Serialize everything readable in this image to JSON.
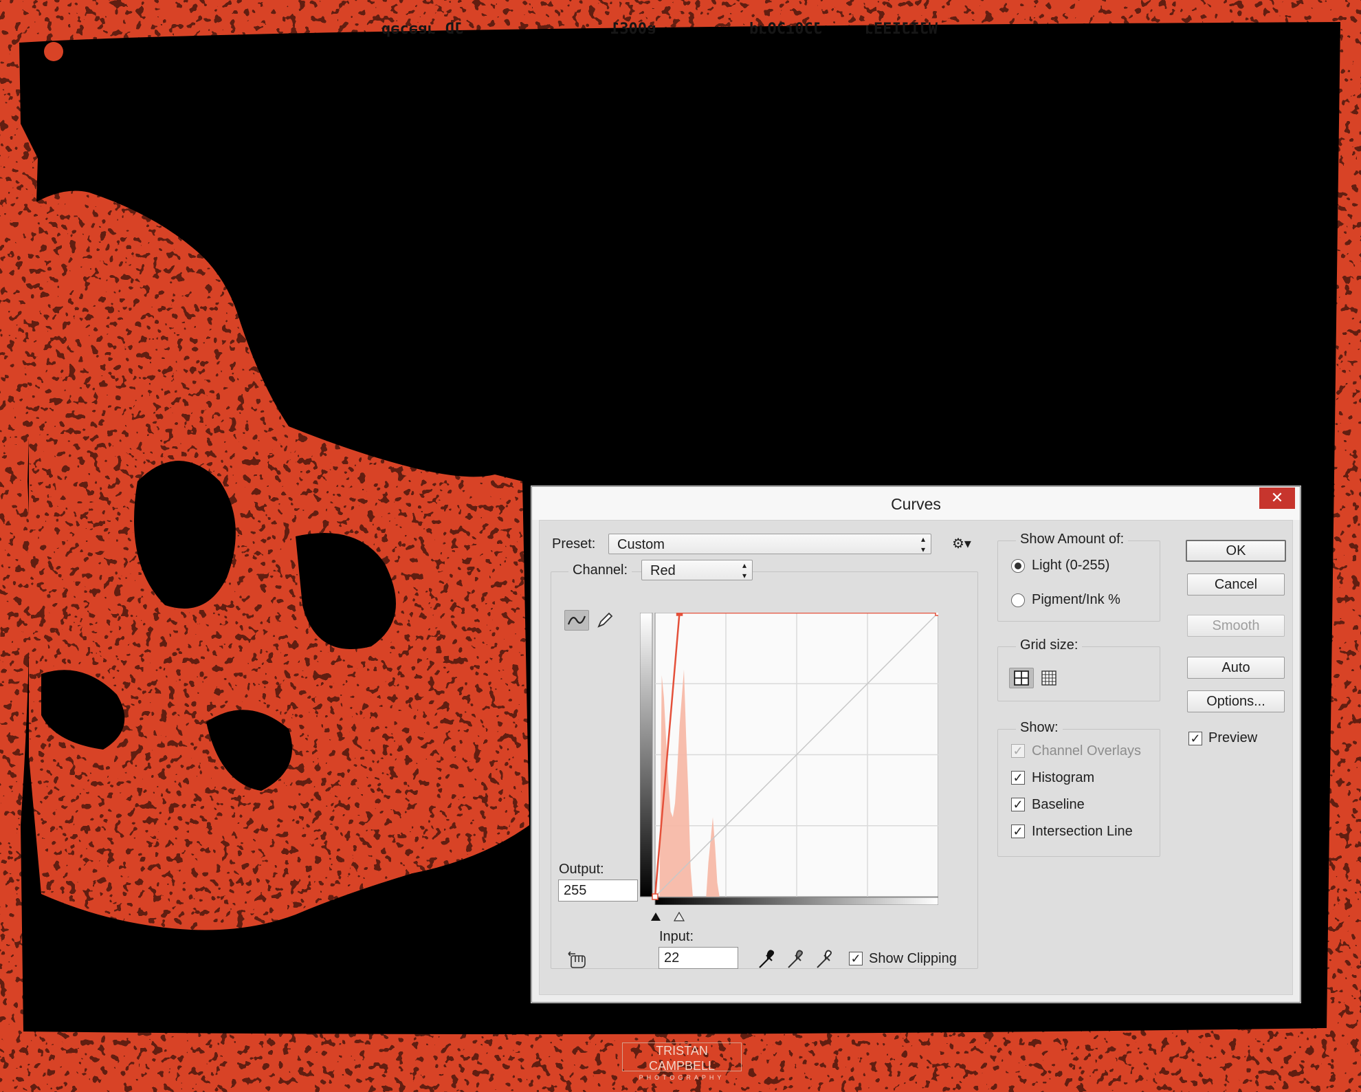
{
  "background": {
    "film_edge_codes": [
      "JD ɹɐǝɔǝp",
      "ɐ00Ɛ1",
      "JƆ0ɾƆOɹd",
      "WJIJIƎƎɹ"
    ],
    "watermark_line1": "TRISTAN CAMPBELL",
    "watermark_line2": "PHOTOGRAPHY",
    "accent_color": "#d84326"
  },
  "dialog": {
    "title": "Curves",
    "close_glyph": "✕",
    "preset": {
      "label": "Preset:",
      "value": "Custom"
    },
    "channel": {
      "label": "Channel:",
      "value": "Red"
    },
    "output": {
      "label": "Output:",
      "value": "255"
    },
    "input": {
      "label": "Input:",
      "value": "22"
    },
    "show_clipping": {
      "label": "Show Clipping",
      "checked": true
    },
    "show_amount": {
      "legend": "Show Amount of:",
      "light": {
        "label": "Light  (0-255)",
        "selected": true
      },
      "pigment": {
        "label": "Pigment/Ink %",
        "selected": false
      }
    },
    "grid_size": {
      "legend": "Grid size:"
    },
    "show": {
      "legend": "Show:",
      "channel_overlays": {
        "label": "Channel Overlays",
        "checked": true,
        "disabled": true
      },
      "histogram": {
        "label": "Histogram",
        "checked": true
      },
      "baseline": {
        "label": "Baseline",
        "checked": true
      },
      "intersection_line": {
        "label": "Intersection Line",
        "checked": true
      }
    },
    "buttons": {
      "ok": "OK",
      "cancel": "Cancel",
      "smooth": "Smooth",
      "auto": "Auto",
      "options": "Options..."
    },
    "preview": {
      "label": "Preview",
      "checked": true
    },
    "curve": {
      "input_range": [
        0,
        255
      ],
      "output_range": [
        0,
        255
      ],
      "points": [
        [
          0,
          0
        ],
        [
          22,
          255
        ],
        [
          255,
          255
        ]
      ]
    }
  }
}
